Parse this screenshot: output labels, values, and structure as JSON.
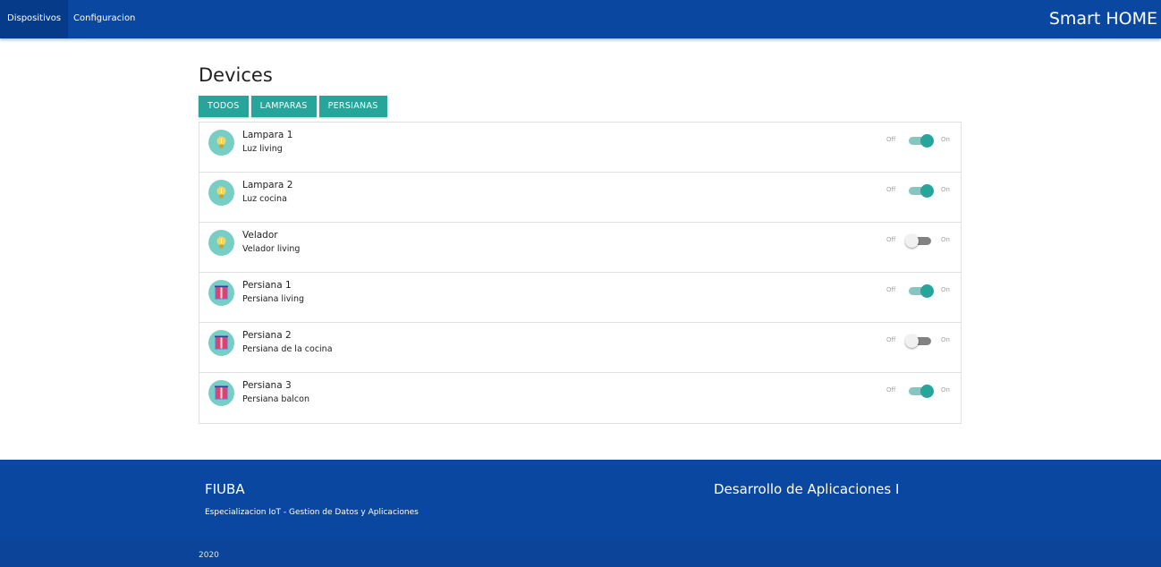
{
  "nav": {
    "items": [
      {
        "label": "Dispositivos",
        "active": true
      },
      {
        "label": "Configuracion",
        "active": false
      }
    ],
    "brand": "Smart HOME"
  },
  "main": {
    "title": "Devices",
    "filters": [
      {
        "label": "TODOS"
      },
      {
        "label": "LAMPARAS"
      },
      {
        "label": "PERSIANAS"
      }
    ],
    "switch_off_label": "Off",
    "switch_on_label": "On",
    "devices": [
      {
        "name": "Lampara 1",
        "description": "Luz living",
        "icon": "lightbulb-icon",
        "on": true
      },
      {
        "name": "Lampara 2",
        "description": "Luz cocina",
        "icon": "lightbulb-icon",
        "on": true
      },
      {
        "name": "Velador",
        "description": "Velador living",
        "icon": "lightbulb-icon",
        "on": false
      },
      {
        "name": "Persiana 1",
        "description": "Persiana living",
        "icon": "window-blind-icon",
        "on": true
      },
      {
        "name": "Persiana 2",
        "description": "Persiana de la cocina",
        "icon": "window-blind-icon",
        "on": false
      },
      {
        "name": "Persiana 3",
        "description": "Persiana balcon",
        "icon": "window-blind-icon",
        "on": true
      }
    ]
  },
  "footer": {
    "left_title": "FIUBA",
    "left_text": "Especializacion IoT - Gestion de Datos y Aplicaciones",
    "right_title": "Desarrollo de Aplicaciones I",
    "copyright": "2020"
  },
  "colors": {
    "primary": "#0a47a1",
    "accent": "#26a69a",
    "avatar_bg": "#76cec4"
  }
}
